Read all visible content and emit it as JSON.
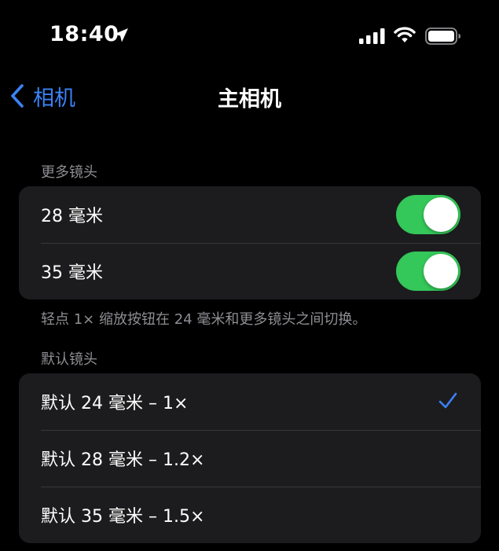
{
  "status_bar": {
    "time": "18:40",
    "icons": [
      "location-arrow-icon",
      "cellular-signal-icon",
      "wifi-icon",
      "battery-icon"
    ]
  },
  "nav": {
    "back_label": "相机",
    "title": "主相机"
  },
  "more_lenses": {
    "header": "更多镜头",
    "items": [
      {
        "label": "28 毫米",
        "toggle_on": true
      },
      {
        "label": "35 毫米",
        "toggle_on": true
      }
    ],
    "footer": "轻点 1× 缩放按钮在 24 毫米和更多镜头之间切换。"
  },
  "default_lens": {
    "header": "默认镜头",
    "options": [
      {
        "label": "默认 24 毫米 – 1×",
        "selected": true
      },
      {
        "label": "默认 28 毫米 – 1.2×",
        "selected": false
      },
      {
        "label": "默认 35 毫米 – 1.5×",
        "selected": false
      }
    ]
  },
  "colors": {
    "accent": "#3b82f6",
    "toggle_on": "#34c759",
    "background": "#000000",
    "group_background": "#1c1c1e",
    "secondary_text": "#8e8e93"
  }
}
